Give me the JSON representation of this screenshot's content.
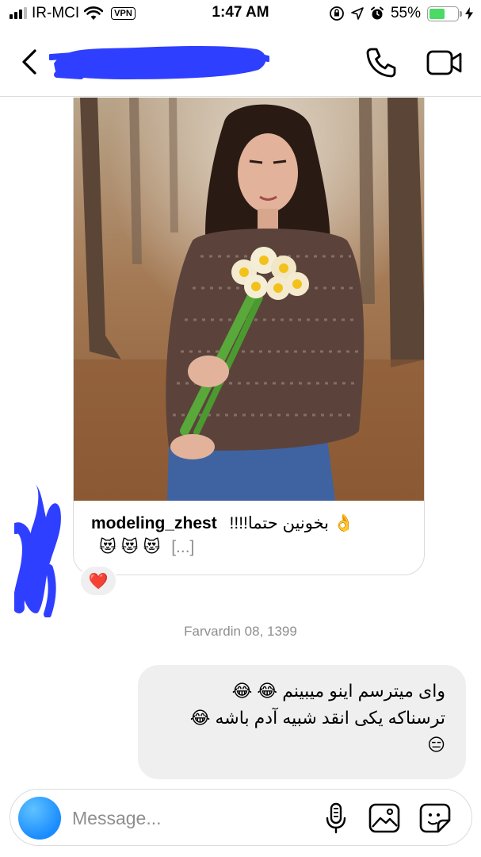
{
  "status_bar": {
    "carrier": "IR-MCI",
    "vpn_label": "VPN",
    "time": "1:47 AM",
    "battery_percent": "55%",
    "battery_level": 0.55,
    "icons": [
      "signal-icon",
      "wifi-icon",
      "vpn-icon",
      "orientation-lock-icon",
      "location-icon",
      "alarm-icon",
      "battery-icon",
      "charging-icon"
    ]
  },
  "header": {
    "icons": [
      "back-icon",
      "phone-icon",
      "video-call-icon"
    ],
    "redaction_color": "#2f3fff"
  },
  "shared_post": {
    "username": "modeling_zhest",
    "caption_text": "بخونین حتما!!!!",
    "caption_emoji_lead": "👌",
    "caption_emoji_line2": "😻 😻 😻",
    "more_label": "[...]",
    "reaction_emoji": "❤️"
  },
  "date_separator": "Farvardin 08, 1399",
  "message": {
    "line1": "وای میترسم اینو میبینم 😂 😂",
    "line2": "ترسناکه یکی انقد شبیه آدم باشه 😂",
    "line3": "😑"
  },
  "composer": {
    "placeholder": "Message...",
    "icons": [
      "camera-icon",
      "microphone-icon",
      "gallery-icon",
      "sticker-icon"
    ],
    "camera_color": "#1a8cff"
  }
}
